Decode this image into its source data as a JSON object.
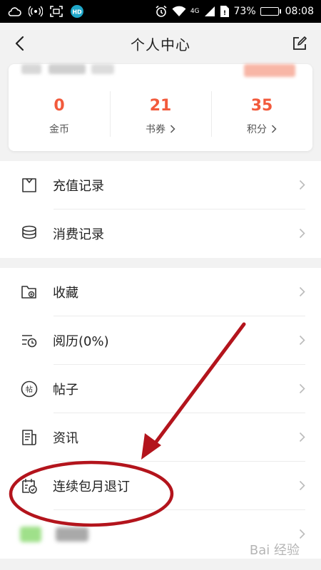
{
  "status_bar": {
    "battery": "73%",
    "battery_level": 0.73,
    "time": "08:08",
    "network": "4G"
  },
  "header": {
    "title": "个人中心",
    "back_icon": "chevron-left-icon",
    "edit_icon": "edit-icon"
  },
  "stats": [
    {
      "value": "0",
      "label": "金币",
      "has_arrow": false
    },
    {
      "value": "21",
      "label": "书券",
      "has_arrow": true
    },
    {
      "value": "35",
      "label": "积分",
      "has_arrow": true
    }
  ],
  "menu_group_1": [
    {
      "label": "充值记录",
      "icon": "recharge-icon"
    },
    {
      "label": "消费记录",
      "icon": "coins-icon"
    }
  ],
  "menu_group_2": [
    {
      "label": "收藏",
      "icon": "folder-icon"
    },
    {
      "label": "阅历(0%)",
      "icon": "history-icon"
    },
    {
      "label": "帖子",
      "icon": "post-icon"
    },
    {
      "label": "资讯",
      "icon": "news-icon"
    },
    {
      "label": "连续包月退订",
      "icon": "calendar-check-icon"
    }
  ],
  "watermark": "Bai 经验",
  "colors": {
    "accent": "#f25a3c",
    "annotation": "#b3141c"
  }
}
